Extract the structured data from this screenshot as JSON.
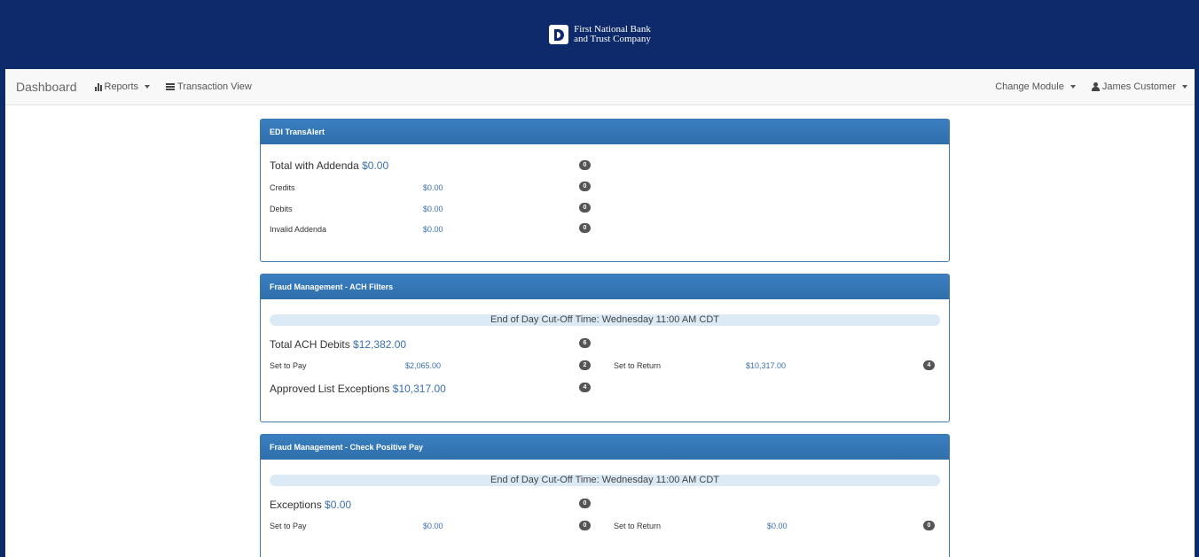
{
  "header": {
    "logo_line1": "First National Bank",
    "logo_line2": "and Trust Company"
  },
  "nav": {
    "brand": "Dashboard",
    "reports": "Reports",
    "transaction_view": "Transaction View",
    "change_module": "Change Module",
    "user": "James Customer"
  },
  "edi": {
    "title": "EDI TransAlert",
    "total_label": "Total with Addenda",
    "total_amount": "$0.00",
    "total_count": "0",
    "rows": [
      {
        "label": "Credits",
        "amount": "$0.00",
        "count": "0"
      },
      {
        "label": "Debits",
        "amount": "$0.00",
        "count": "0"
      },
      {
        "label": "Invalid Addenda",
        "amount": "$0.00",
        "count": "0"
      }
    ]
  },
  "ach": {
    "title": "Fraud Management - ACH Filters",
    "cutoff": "End of Day Cut-Off Time: Wednesday 11:00 AM CDT",
    "total_label": "Total ACH Debits",
    "total_amount": "$12,382.00",
    "total_count": "6",
    "pay_label": "Set to Pay",
    "pay_amount": "$2,065.00",
    "pay_count": "2",
    "return_label": "Set to Return",
    "return_amount": "$10,317.00",
    "return_count": "4",
    "approved_label": "Approved List Exceptions",
    "approved_amount": "$10,317.00",
    "approved_count": "4"
  },
  "check": {
    "title": "Fraud Management - Check Positive Pay",
    "cutoff": "End of Day Cut-Off Time: Wednesday 11:00 AM CDT",
    "exceptions_label": "Exceptions",
    "exceptions_amount": "$0.00",
    "exceptions_count": "0",
    "pay_label": "Set to Pay",
    "pay_amount": "$0.00",
    "pay_count": "0",
    "return_label": "Set to Return",
    "return_amount": "$0.00",
    "return_count": "0"
  }
}
